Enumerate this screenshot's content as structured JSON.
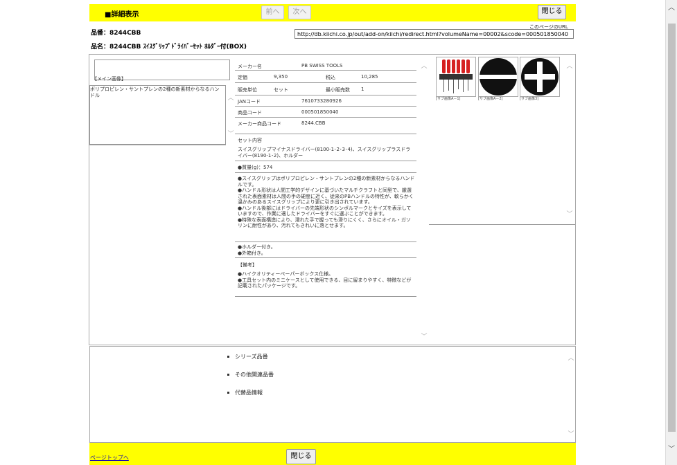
{
  "header": {
    "title": "■詳細表示",
    "prev_label": "前へ",
    "next_label": "次へ",
    "close_label": "閉じる"
  },
  "product": {
    "code_label": "品番：",
    "code_value": "8244CBB",
    "name_label": "品名：",
    "name_value": "8244CBB ｽｲｽｸﾞﾘｯﾌﾟﾄﾞﾗｲﾊﾞｰｾｯﾄ ﾎﾙﾀﾞｰ付(BOX)"
  },
  "url_block": {
    "label": "このページのURL",
    "value": "http://db.kiichi.co.jp/out/add-on/kiichi/redirect.html?volumeName=00002&scode=000501850040"
  },
  "left_panel": {
    "main_image_label": "【メイン画像】",
    "description": "ポリプロピレン・サントプレンの2種の新素材からなるハンドル"
  },
  "specs": {
    "maker_label": "メーカー名",
    "maker_value": "PB SWISS TOOLS",
    "price_label": "定価",
    "price_value": "9,350",
    "taxin_label": "税込",
    "taxin_value": "10,285",
    "unit_label": "販売単位",
    "unit_value": "セット",
    "minqty_label": "最小販売数",
    "minqty_value": "1",
    "jan_label": "JANコード",
    "jan_value": "7610733280926",
    "itemcode_label": "商品コード",
    "itemcode_value": "000501850040",
    "makercode_label": "メーカー商品コード",
    "makercode_value": "8244.CBB"
  },
  "details": {
    "set_heading": "セット内容",
    "set_contents": "スイスグリップマイナスドライバー(8100-1･2･3･4)、スイスグリップラスドライバー(8190-1･2)、ホルダー",
    "weight": "●質量(g)：574",
    "features": "●スイスグリップはポリプロピレン・サントプレンの2種の新素材からなるハンドルです。\n●ハンドル形状は人間工学的デザインに基づいたマルチクラフトと同型で、厳選された表面素材は人間の手の硬度に近く、従来のPBハンドルの特性が、軟らかく温かみのあるスイスグリップにより更に引き出されています。\n●ハンドル後部にはドライバーの先端形状のシンボルマークとサイズを表示していますので、作業に適したドライバーをすぐに選ぶことができます。\n●特殊な表面構造により、濡れた手で握っても滑りにくく、さらにオイル・ガソリンに耐性があり、汚れてもきれいに落とせます。",
    "accessories": "●ホルダー付き。\n●外箱付き。",
    "remarks_heading": "【備考】",
    "remarks": "●ハイクオリティーペーパーボックス仕様。\n●工具セット内のミニケースとして使用できる、目に留まりやすく、特徴などが記載されたパッケージです。"
  },
  "thumbnails": [
    {
      "caption": "[サブ画像A－1]",
      "icon": "screwdriver-set-icon"
    },
    {
      "caption": "[サブ画像A－2]",
      "icon": "slotted-tip-symbol-icon"
    },
    {
      "caption": "[サブ画像3]",
      "icon": "phillips-tip-symbol-icon"
    }
  ],
  "related": [
    {
      "label": "シリーズ品番"
    },
    {
      "label": "その他関連品番"
    },
    {
      "label": "代替品情報"
    }
  ],
  "footer": {
    "page_top_label": "ページトップへ",
    "close_label": "閉じる"
  },
  "colors": {
    "header_yellow": "#ffff00",
    "link_blue": "#1a0dab"
  }
}
